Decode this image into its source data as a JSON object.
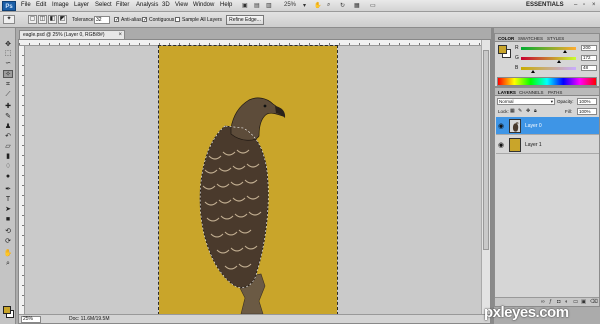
{
  "app": {
    "logo": "Ps"
  },
  "menubar": {
    "items": [
      "File",
      "Edit",
      "Image",
      "Layer",
      "Select",
      "Filter",
      "Analysis",
      "3D",
      "View",
      "Window",
      "Help"
    ],
    "zoom_readout": "25%",
    "workspace": "ESSENTIALS",
    "icons": [
      "bridge-icon",
      "minibridge-icon",
      "hand-icon",
      "zoom-icon",
      "rotate-icon",
      "arrange-icon",
      "screen-mode-icon"
    ]
  },
  "options_bar": {
    "tolerance_label": "Tolerance:",
    "tolerance_value": "32",
    "antialias_label": "Anti-alias",
    "contiguous_label": "Contiguous",
    "sample_all_label": "Sample All Layers",
    "refine_edge_label": "Refine Edge...",
    "antialias_checked": true,
    "contiguous_checked": true,
    "sample_all_checked": false
  },
  "toolbox": {
    "tools": [
      "move-tool-icon",
      "marquee-tool-icon",
      "lasso-tool-icon",
      "magic-wand-tool-icon",
      "crop-tool-icon",
      "eyedropper-tool-icon",
      "healing-brush-tool-icon",
      "brush-tool-icon",
      "clone-stamp-tool-icon",
      "history-brush-tool-icon",
      "eraser-tool-icon",
      "gradient-tool-icon",
      "blur-tool-icon",
      "dodge-tool-icon",
      "pen-tool-icon",
      "type-tool-icon",
      "path-selection-tool-icon",
      "shape-tool-icon",
      "3d-rotate-tool-icon",
      "3d-camera-tool-icon",
      "hand-tool-icon",
      "zoom-tool-icon"
    ],
    "selected_index": 3,
    "foreground_color": "#c9a52a",
    "background_color": "#ffffff"
  },
  "document": {
    "tab_title": "eagle.psd @ 25% (Layer 0, RGB/8#)",
    "canvas_color": "#c9a52a",
    "status_zoom": "25%",
    "status_doc": "Doc: 11.6M/19.5M"
  },
  "color_panel": {
    "tabs": [
      "COLOR",
      "SWATCHES",
      "STYLES"
    ],
    "active_tab": "COLOR",
    "channels": [
      {
        "label": "R",
        "value": "200"
      },
      {
        "label": "G",
        "value": "172"
      },
      {
        "label": "B",
        "value": "48"
      }
    ],
    "swatch_color": "#c9a52a"
  },
  "layers_panel": {
    "tabs": [
      "LAYERS",
      "CHANNELS",
      "PATHS"
    ],
    "active_tab": "LAYERS",
    "blend_mode": "Normal",
    "opacity_label": "Opacity:",
    "opacity_value": "100%",
    "lock_label": "Lock:",
    "fill_label": "Fill:",
    "fill_value": "100%",
    "layers": [
      {
        "name": "Layer 0",
        "selected": true,
        "thumb": "bird",
        "visible": true
      },
      {
        "name": "Layer 1",
        "selected": false,
        "thumb": "#c9a52a",
        "visible": true
      }
    ],
    "footer_icons": [
      "link-icon",
      "fx-icon",
      "mask-icon",
      "adjustment-icon",
      "group-icon",
      "new-layer-icon",
      "trash-icon"
    ]
  },
  "watermark": "pxleyes.com"
}
